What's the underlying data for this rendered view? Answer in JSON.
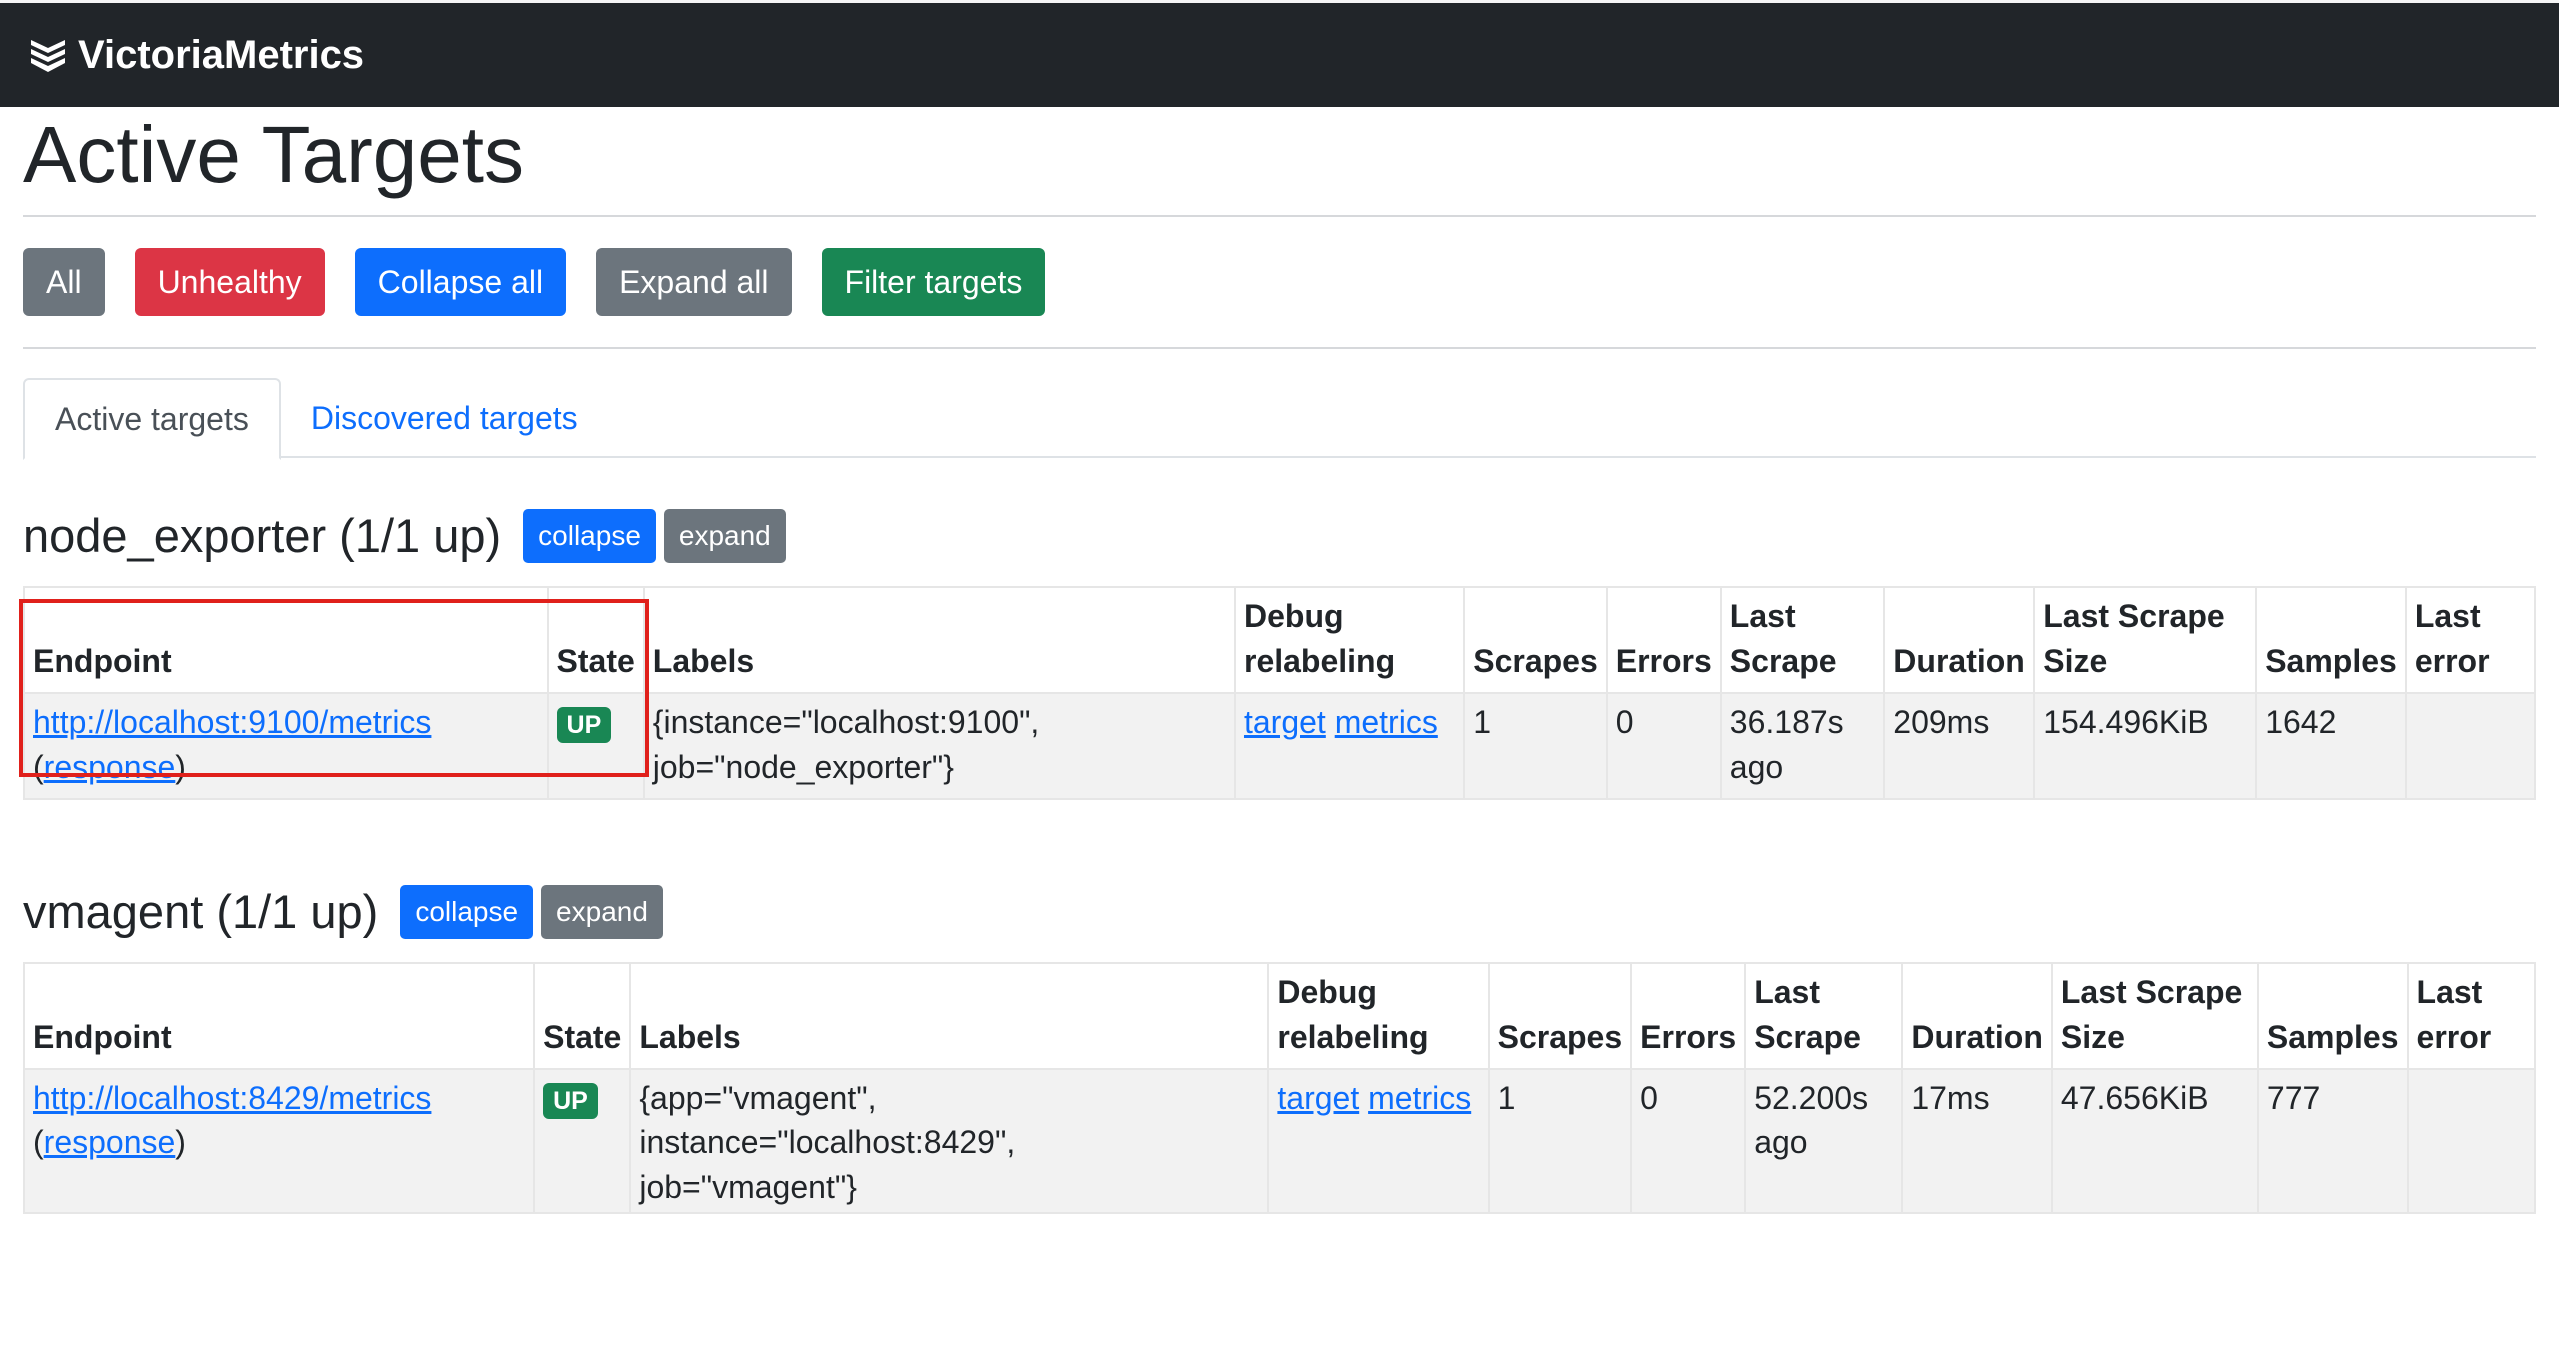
{
  "app": {
    "brand": "VictoriaMetrics"
  },
  "page": {
    "title": "Active Targets"
  },
  "filters": {
    "all": "All",
    "unhealthy": "Unhealthy",
    "collapse_all": "Collapse all",
    "expand_all": "Expand all",
    "filter_targets": "Filter targets"
  },
  "tabs": {
    "active": "Active targets",
    "discovered": "Discovered targets"
  },
  "columns": {
    "endpoint": "Endpoint",
    "state": "State",
    "labels": "Labels",
    "debug_1": "Debug",
    "debug_2": "relabeling",
    "scrapes": "Scrapes",
    "errors": "Errors",
    "last_scrape_1": "Last",
    "last_scrape_2": "Scrape",
    "duration": "Duration",
    "size_1": "Last Scrape",
    "size_2": "Size",
    "samples": "Samples",
    "last_error_1": "Last",
    "last_error_2": "error"
  },
  "groups": [
    {
      "title": "node_exporter (1/1 up)",
      "collapse": "collapse",
      "expand": "expand",
      "row": {
        "endpoint": "http://localhost:9100/metrics",
        "response_open": "(",
        "response": "response",
        "response_close": ")",
        "state": "UP",
        "labels_1": "{instance=\"localhost:9100\",",
        "labels_2": "job=\"node_exporter\"}",
        "debug_target": "target",
        "debug_metrics": "metrics",
        "scrapes": "1",
        "errors": "0",
        "last_scrape_1": "36.187s",
        "last_scrape_2": "ago",
        "duration": "209ms",
        "size": "154.496KiB",
        "samples": "1642",
        "last_error": ""
      }
    },
    {
      "title": "vmagent (1/1 up)",
      "collapse": "collapse",
      "expand": "expand",
      "row": {
        "endpoint": "http://localhost:8429/metrics",
        "response_open": "(",
        "response": "response",
        "response_close": ")",
        "state": "UP",
        "labels_1": "{app=\"vmagent\", instance=\"localhost:8429\",",
        "labels_2": "job=\"vmagent\"}",
        "debug_target": "target",
        "debug_metrics": "metrics",
        "scrapes": "1",
        "errors": "0",
        "last_scrape_1": "52.200s",
        "last_scrape_2": "ago",
        "duration": "17ms",
        "size": "47.656KiB",
        "samples": "777",
        "last_error": ""
      }
    }
  ],
  "colors": {
    "navbar": "#212529",
    "primary": "#0d6efd",
    "secondary": "#6c757d",
    "danger": "#dc3545",
    "success": "#198754",
    "highlight": "#e0201b"
  }
}
